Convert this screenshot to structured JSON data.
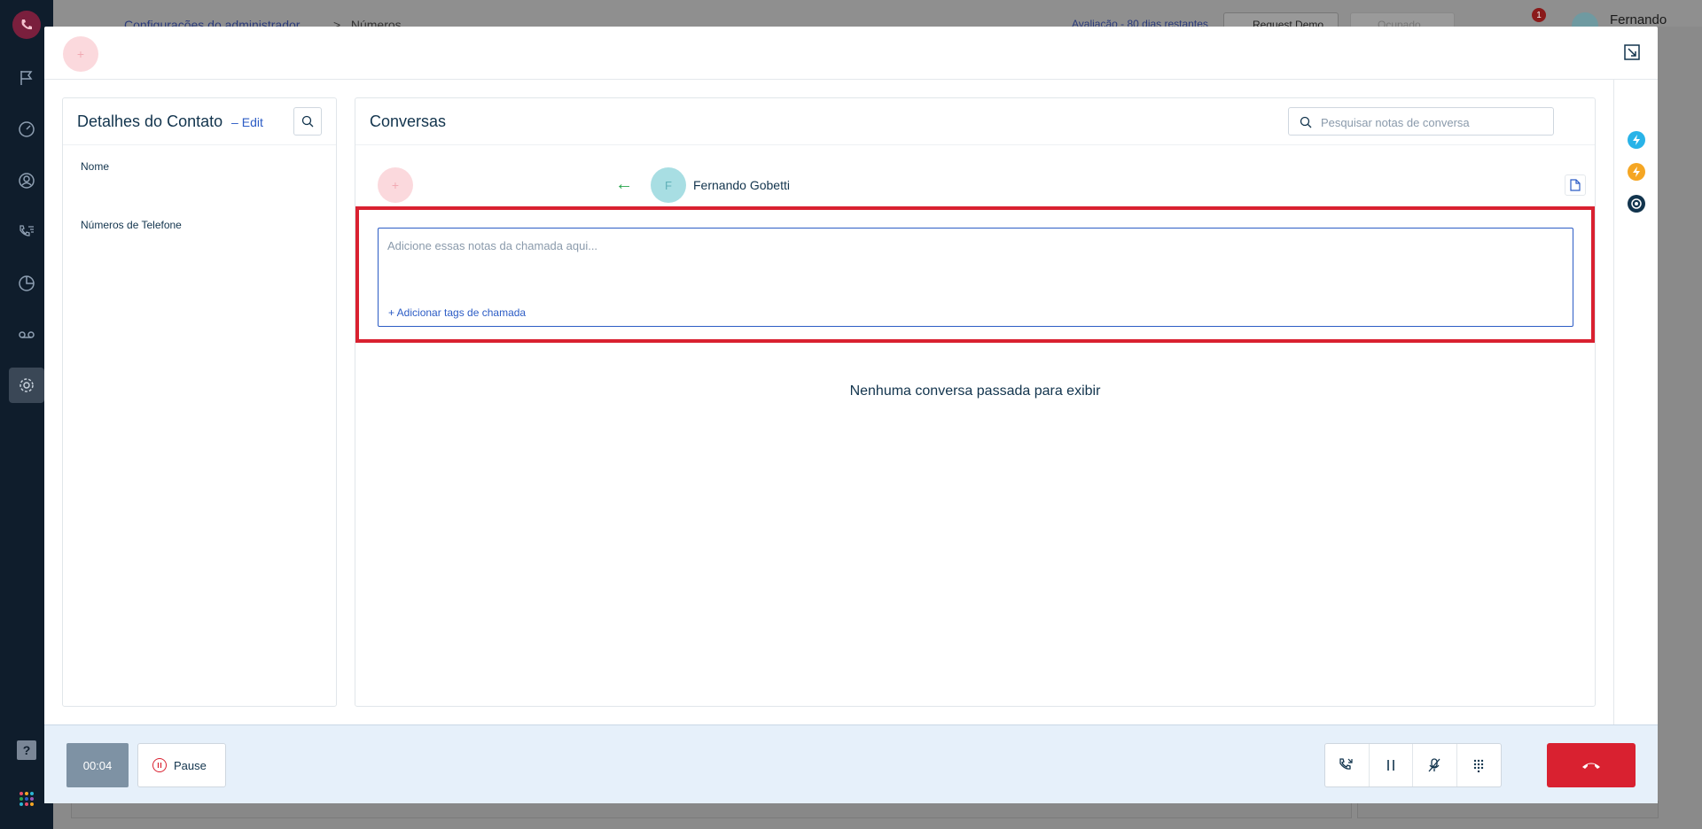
{
  "background": {
    "breadcrumb": {
      "parent": "Configurações do administrador",
      "separator": ">",
      "current": "Números"
    },
    "trial_text": "Avaliação - 80 dias restantes",
    "request_demo": "Request Demo",
    "status": "Ocupado",
    "notification_count": "1",
    "user_name": "Fernando Gobetti"
  },
  "modal": {
    "header_avatar": "+"
  },
  "contact": {
    "title": "Detalhes do Contato",
    "edit_dash": "–",
    "edit_label": "Edit",
    "fields": {
      "name_label": "Nome",
      "phones_label": "Números de Telefone"
    }
  },
  "conversations": {
    "title": "Conversas",
    "search_placeholder": "Pesquisar notas de conversa",
    "agent_avatar": "+",
    "direction_arrow": "←",
    "caller_initial": "F",
    "caller_name": "Fernando Gobetti",
    "notes_placeholder": "Adicione essas notas da chamada aqui...",
    "add_tags_label": "+ Adicionar tags de chamada",
    "empty_message": "Nenhuma conversa passada para exibir"
  },
  "call_bar": {
    "timer": "00:04",
    "pause_label": "Pause"
  },
  "colors": {
    "accent": "#2c5cc5",
    "danger": "#d92130",
    "success": "#27a54c",
    "sidebar": "#0f1d2c",
    "bottom_bar": "#e6f0fa"
  }
}
